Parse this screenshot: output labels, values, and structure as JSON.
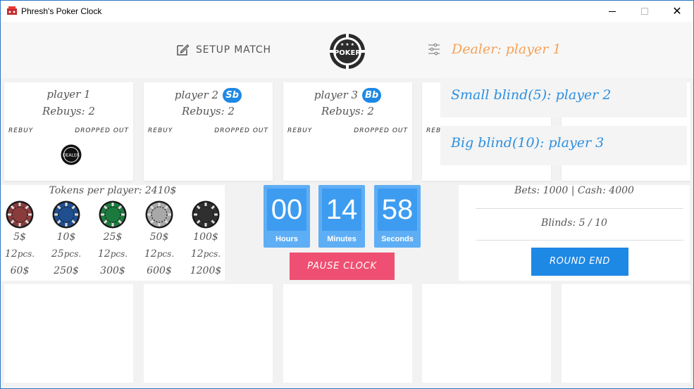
{
  "window": {
    "title": "Phresh's Poker Clock"
  },
  "header": {
    "setup_label": "SETUP MATCH",
    "dealer": "Dealer: player 1",
    "logo_text": "POKER"
  },
  "overlay": {
    "small_blind": "Small blind(5): player 2",
    "big_blind": "Big blind(10): player 3"
  },
  "players": [
    {
      "name": "player 1",
      "badge": "",
      "rebuys": "Rebuys: 2",
      "rebuy_label": "REBUY",
      "dropped_label": "DROPPED OUT",
      "dealer_chip": "DEALER"
    },
    {
      "name": "player 2",
      "badge": "Sb",
      "rebuys": "Rebuys: 2",
      "rebuy_label": "REBUY",
      "dropped_label": "DROPPED OUT"
    },
    {
      "name": "player 3",
      "badge": "Bb",
      "rebuys": "Rebuys: 2",
      "rebuy_label": "REBUY",
      "dropped_label": "DROPPED OUT"
    },
    {
      "rebuy_label": "REB"
    }
  ],
  "tokens": {
    "title": "Tokens per player: 2410$",
    "chips": [
      {
        "value": "5$",
        "pcs": "12",
        "total": "60$",
        "color": "#8a3b3b"
      },
      {
        "value": "10$",
        "pcs": "25",
        "total": "250$",
        "color": "#1f4f8f"
      },
      {
        "value": "25$",
        "pcs": "12",
        "total": "300$",
        "color": "#1d7a3f"
      },
      {
        "value": "50$",
        "pcs": "12",
        "total": "600$",
        "color": "#a8a8a8"
      },
      {
        "value": "100$",
        "pcs": "12",
        "total": "1200$",
        "color": "#2f2f2f"
      }
    ],
    "pcs_suffix": "pcs."
  },
  "clock": {
    "hours": "00",
    "minutes": "14",
    "seconds": "58",
    "hours_label": "Hours",
    "minutes_label": "Minutes",
    "seconds_label": "Seconds",
    "pause_label": "PAUSE CLOCK"
  },
  "bets": {
    "summary": "Bets: 1000 | Cash: 4000",
    "blinds": "Blinds: 5 / 10",
    "round_end_label": "ROUND END"
  },
  "colors": {
    "accent_blue": "#1e88e5",
    "dealer_orange": "#f5a257",
    "pause_pink": "#ef4f72",
    "timer_blue": "#5eaef5"
  }
}
